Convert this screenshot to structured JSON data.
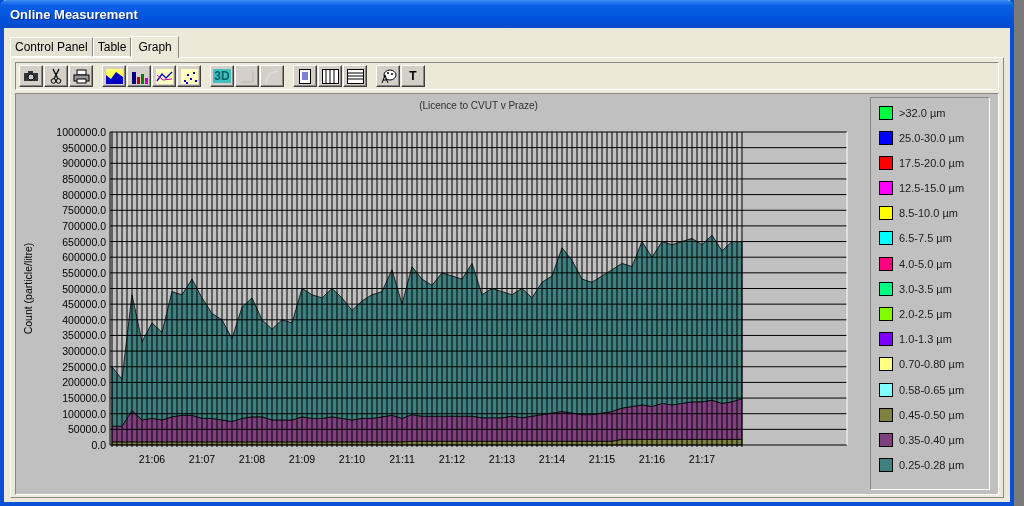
{
  "window": {
    "title": "Online Measurement"
  },
  "tabs": [
    {
      "label": "Control Panel",
      "selected": false
    },
    {
      "label": "Table",
      "selected": false
    },
    {
      "label": "Graph",
      "selected": true
    }
  ],
  "toolbar": [
    [
      {
        "kind": "camera",
        "disabled": false
      },
      {
        "kind": "scissors",
        "disabled": false
      },
      {
        "kind": "printer",
        "disabled": false
      }
    ],
    [
      {
        "kind": "area",
        "disabled": false
      },
      {
        "kind": "bar",
        "disabled": false
      },
      {
        "kind": "line",
        "disabled": false
      },
      {
        "kind": "scatter",
        "disabled": false
      }
    ],
    [
      {
        "kind": "text",
        "label": "3D",
        "disabled": false
      },
      {
        "kind": "corner",
        "disabled": true
      },
      {
        "kind": "curve",
        "disabled": true
      }
    ],
    [
      {
        "kind": "page",
        "disabled": false
      },
      {
        "kind": "columns",
        "disabled": false
      },
      {
        "kind": "rows",
        "disabled": false
      }
    ],
    [
      {
        "kind": "palette",
        "disabled": false
      },
      {
        "kind": "text",
        "label": "T",
        "disabled": false
      }
    ]
  ],
  "chart": {
    "chart_data": {
      "type": "area",
      "stacked": true,
      "title": "(Licence to CVUT v Praze)",
      "ylabel": "Count (particle/litre)",
      "ylim": [
        0,
        1000000
      ],
      "yticks": [
        {
          "value": 0,
          "label": "0.0"
        },
        {
          "value": 50000,
          "label": "50000.0"
        },
        {
          "value": 100000,
          "label": "100000.0"
        },
        {
          "value": 150000,
          "label": "150000.0"
        },
        {
          "value": 200000,
          "label": "200000.0"
        },
        {
          "value": 250000,
          "label": "250000.0"
        },
        {
          "value": 300000,
          "label": "300000.0"
        },
        {
          "value": 350000,
          "label": "350000.0"
        },
        {
          "value": 400000,
          "label": "400000.0"
        },
        {
          "value": 450000,
          "label": "450000.0"
        },
        {
          "value": 500000,
          "label": "500000.0"
        },
        {
          "value": 550000,
          "label": "550000.0"
        },
        {
          "value": 600000,
          "label": "600000.0"
        },
        {
          "value": 650000,
          "label": "650000.0"
        },
        {
          "value": 700000,
          "label": "700000.0"
        },
        {
          "value": 750000,
          "label": "750000.0"
        },
        {
          "value": 800000,
          "label": "800000.0"
        },
        {
          "value": 850000,
          "label": "850000.0"
        },
        {
          "value": 900000,
          "label": "900000.0"
        },
        {
          "value": 950000,
          "label": "950000.0"
        },
        {
          "value": 1000000,
          "label": "1000000.0"
        }
      ],
      "grid": true,
      "categories": [
        null,
        null,
        null,
        null,
        "21:06",
        null,
        null,
        null,
        null,
        "21:07",
        null,
        null,
        null,
        null,
        "21:08",
        null,
        null,
        null,
        null,
        "21:09",
        null,
        null,
        null,
        null,
        "21:10",
        null,
        null,
        null,
        null,
        "21:11",
        null,
        null,
        null,
        null,
        "21:12",
        null,
        null,
        null,
        null,
        "21:13",
        null,
        null,
        null,
        null,
        "21:14",
        null,
        null,
        null,
        null,
        "21:15",
        null,
        null,
        null,
        null,
        "21:16",
        null,
        null,
        null,
        null,
        "21:17",
        null,
        null,
        null,
        null
      ],
      "series": [
        {
          "name": "0.45-0.50 µm",
          "color": "#808040",
          "values": [
            10000,
            10000,
            10000,
            10000,
            10000,
            10000,
            10000,
            10000,
            10000,
            10000,
            10000,
            10000,
            10000,
            10000,
            10000,
            10000,
            10000,
            10000,
            10000,
            10000,
            10000,
            10000,
            10000,
            10000,
            10000,
            10000,
            10000,
            10000,
            10000,
            10000,
            12000,
            12000,
            12000,
            12000,
            12000,
            12000,
            12000,
            12000,
            12000,
            12000,
            12000,
            12000,
            12000,
            12000,
            12000,
            12000,
            12000,
            12000,
            12000,
            12000,
            12000,
            18000,
            18000,
            18000,
            18000,
            18000,
            18000,
            18000,
            18000,
            18000,
            18000,
            18000,
            18000,
            18000
          ]
        },
        {
          "name": "0.35-0.40 µm",
          "color": "#804080",
          "values": [
            50000,
            50000,
            100000,
            70000,
            75000,
            70000,
            80000,
            85000,
            85000,
            75000,
            75000,
            70000,
            65000,
            75000,
            80000,
            80000,
            70000,
            70000,
            70000,
            80000,
            75000,
            75000,
            80000,
            75000,
            70000,
            75000,
            75000,
            80000,
            85000,
            75000,
            85000,
            80000,
            80000,
            80000,
            80000,
            80000,
            80000,
            75000,
            75000,
            75000,
            80000,
            75000,
            80000,
            85000,
            90000,
            95000,
            90000,
            85000,
            85000,
            90000,
            95000,
            100000,
            105000,
            110000,
            105000,
            115000,
            110000,
            115000,
            120000,
            120000,
            125000,
            115000,
            120000,
            130000
          ]
        },
        {
          "name": "0.25-0.28 µm",
          "color": "#408080",
          "values": [
            190000,
            150000,
            370000,
            250000,
            305000,
            280000,
            400000,
            385000,
            435000,
            385000,
            335000,
            320000,
            265000,
            355000,
            380000,
            310000,
            290000,
            320000,
            310000,
            410000,
            395000,
            385000,
            410000,
            385000,
            350000,
            375000,
            395000,
            400000,
            465000,
            365000,
            473000,
            438000,
            418000,
            458000,
            448000,
            438000,
            488000,
            393000,
            413000,
            403000,
            388000,
            413000,
            378000,
            423000,
            438000,
            523000,
            488000,
            433000,
            423000,
            438000,
            453000,
            462000,
            447000,
            522000,
            477000,
            517000,
            512000,
            517000,
            522000,
            502000,
            527000,
            487000,
            512000,
            502000
          ]
        }
      ]
    }
  },
  "legend": [
    {
      "label": ">32.0 µm",
      "color": "#00ff40"
    },
    {
      "label": "25.0-30.0 µm",
      "color": "#0000ff"
    },
    {
      "label": "17.5-20.0 µm",
      "color": "#ff0000"
    },
    {
      "label": "12.5-15.0 µm",
      "color": "#ff00ff"
    },
    {
      "label": "8.5-10.0 µm",
      "color": "#ffff00"
    },
    {
      "label": "6.5-7.5 µm",
      "color": "#00ffff"
    },
    {
      "label": "4.0-5.0 µm",
      "color": "#ff0080"
    },
    {
      "label": "3.0-3.5 µm",
      "color": "#00ff80"
    },
    {
      "label": "2.0-2.5 µm",
      "color": "#80ff00"
    },
    {
      "label": "1.0-1.3 µm",
      "color": "#8000ff"
    },
    {
      "label": "0.70-0.80 µm",
      "color": "#ffff80"
    },
    {
      "label": "0.58-0.65 µm",
      "color": "#80ffff"
    }
  ]
}
